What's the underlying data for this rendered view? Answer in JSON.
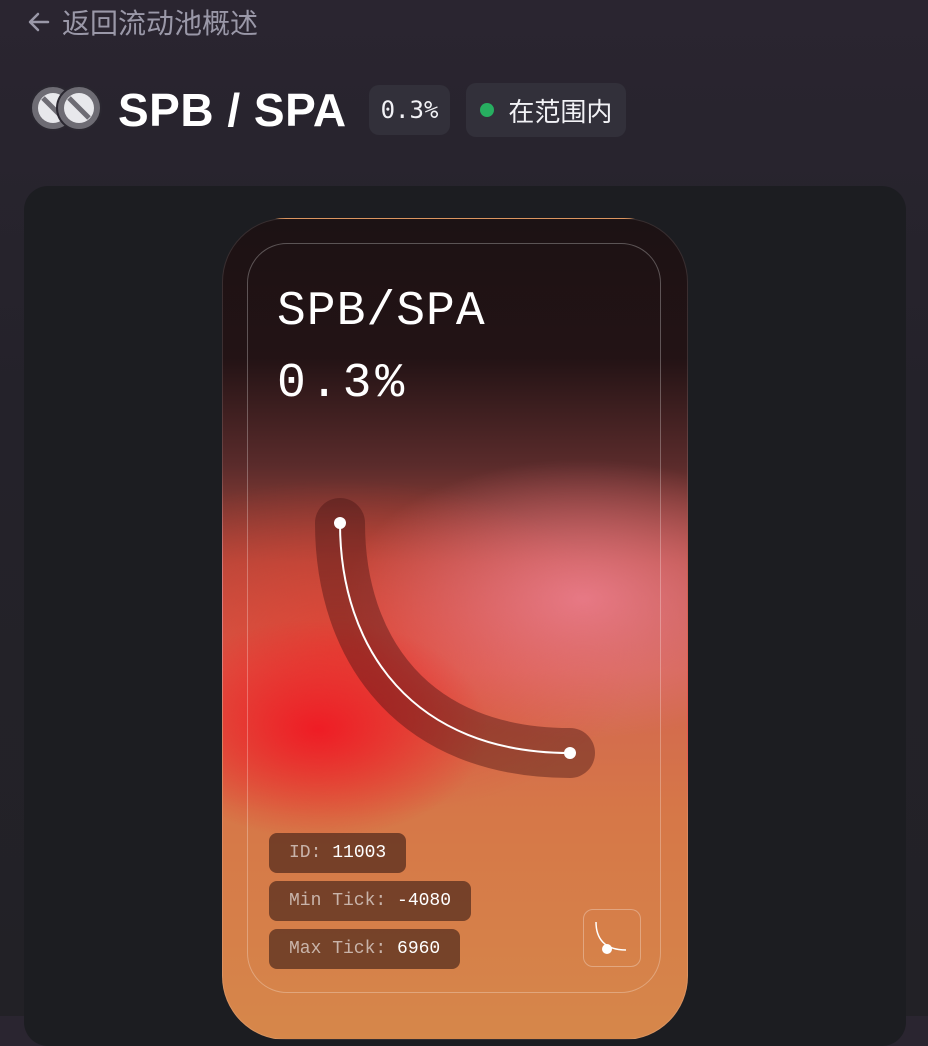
{
  "nav": {
    "back_label": "返回流动池概述"
  },
  "pool": {
    "pair": "SPB / SPA",
    "fee": "0.3%",
    "status": "在范围内",
    "status_color": "#27ae60",
    "token_icons": [
      "token-spb-icon",
      "token-spa-icon"
    ]
  },
  "nft": {
    "pair": "SPB/SPA",
    "fee": "0.3%",
    "id_key": "ID:",
    "id_value": "11003",
    "min_tick_key": "Min Tick:",
    "min_tick_value": "-4080",
    "max_tick_key": "Max Tick:",
    "max_tick_value": "6960"
  }
}
